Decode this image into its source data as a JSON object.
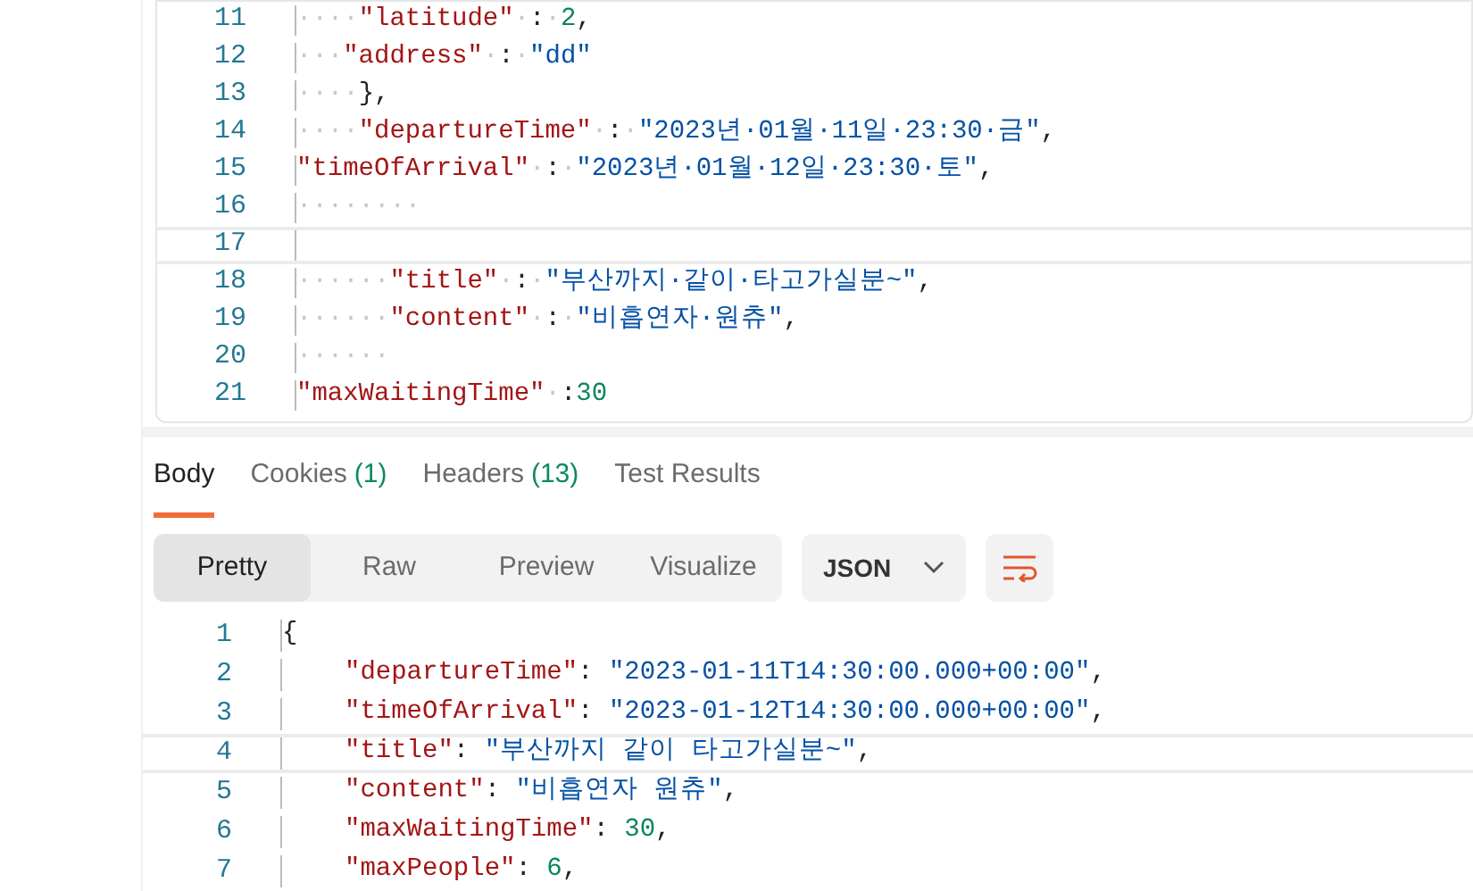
{
  "request_editor": {
    "lines": [
      {
        "number": "11",
        "active": false,
        "tokens": [
          {
            "kind": "space",
            "text": "····"
          },
          {
            "kind": "key",
            "text": "\"latitude\""
          },
          {
            "kind": "space",
            "text": "·"
          },
          {
            "kind": "punct",
            "text": ":"
          },
          {
            "kind": "space",
            "text": "·"
          },
          {
            "kind": "number",
            "text": "2"
          },
          {
            "kind": "punct",
            "text": ","
          }
        ]
      },
      {
        "number": "12",
        "active": false,
        "tokens": [
          {
            "kind": "space",
            "text": "···"
          },
          {
            "kind": "key",
            "text": "\"address\""
          },
          {
            "kind": "space",
            "text": "·"
          },
          {
            "kind": "punct",
            "text": ":"
          },
          {
            "kind": "space",
            "text": "·"
          },
          {
            "kind": "string",
            "text": "\"dd\""
          }
        ]
      },
      {
        "number": "13",
        "active": false,
        "tokens": [
          {
            "kind": "space",
            "text": "····"
          },
          {
            "kind": "punct",
            "text": "},"
          }
        ]
      },
      {
        "number": "14",
        "active": false,
        "tokens": [
          {
            "kind": "space",
            "text": "····"
          },
          {
            "kind": "key",
            "text": "\"departureTime\""
          },
          {
            "kind": "space",
            "text": "·"
          },
          {
            "kind": "punct",
            "text": ":"
          },
          {
            "kind": "space",
            "text": "·"
          },
          {
            "kind": "string",
            "text": "\"2023년·01월·11일·23:30·금\""
          },
          {
            "kind": "punct",
            "text": ","
          }
        ]
      },
      {
        "number": "15",
        "active": false,
        "tokens": [
          {
            "kind": "key",
            "text": "\"timeOfArrival\""
          },
          {
            "kind": "space",
            "text": "·"
          },
          {
            "kind": "punct",
            "text": ":"
          },
          {
            "kind": "space",
            "text": "·"
          },
          {
            "kind": "string",
            "text": "\"2023년·01월·12일·23:30·토\""
          },
          {
            "kind": "punct",
            "text": ","
          }
        ]
      },
      {
        "number": "16",
        "active": false,
        "tokens": [
          {
            "kind": "space",
            "text": "········"
          }
        ]
      },
      {
        "number": "17",
        "active": true
      },
      {
        "number": "18",
        "active": false,
        "tokens": [
          {
            "kind": "space",
            "text": "······"
          },
          {
            "kind": "key",
            "text": "\"title\""
          },
          {
            "kind": "space",
            "text": "·"
          },
          {
            "kind": "punct",
            "text": ":"
          },
          {
            "kind": "space",
            "text": "·"
          },
          {
            "kind": "string",
            "text": "\"부산까지·같이·타고가실분~\""
          },
          {
            "kind": "punct",
            "text": ","
          }
        ]
      },
      {
        "number": "19",
        "active": false,
        "tokens": [
          {
            "kind": "space",
            "text": "······"
          },
          {
            "kind": "key",
            "text": "\"content\""
          },
          {
            "kind": "space",
            "text": "·"
          },
          {
            "kind": "punct",
            "text": ":"
          },
          {
            "kind": "space",
            "text": "·"
          },
          {
            "kind": "string",
            "text": "\"비흡연자·원츄\""
          },
          {
            "kind": "punct",
            "text": ","
          }
        ]
      },
      {
        "number": "20",
        "active": false,
        "tokens": [
          {
            "kind": "space",
            "text": "······"
          }
        ]
      },
      {
        "number": "21",
        "active": false,
        "tokens": [
          {
            "kind": "key",
            "text": "\"maxWaitingTime\""
          },
          {
            "kind": "space",
            "text": "·"
          },
          {
            "kind": "punct",
            "text": ":"
          },
          {
            "kind": "number",
            "text": "30"
          }
        ]
      }
    ]
  },
  "response_tabs": [
    {
      "label": "Body",
      "selected": true
    },
    {
      "label": "Cookies",
      "count": "(1)",
      "selected": false
    },
    {
      "label": "Headers",
      "count": "(13)",
      "selected": false
    },
    {
      "label": "Test Results",
      "selected": false
    }
  ],
  "view_modes": [
    {
      "label": "Pretty",
      "selected": true
    },
    {
      "label": "Raw",
      "selected": false
    },
    {
      "label": "Preview",
      "selected": false
    },
    {
      "label": "Visualize",
      "selected": false
    }
  ],
  "format_dropdown": {
    "value": "JSON"
  },
  "response_body": {
    "lines": [
      {
        "number": "1",
        "active": false,
        "tokens": [
          {
            "kind": "punct",
            "text": "{"
          }
        ]
      },
      {
        "number": "2",
        "active": false,
        "tokens": [
          {
            "kind": "key",
            "text": "\"departureTime\""
          },
          {
            "kind": "punct",
            "text": ": "
          },
          {
            "kind": "string",
            "text": "\"2023-01-11T14:30:00.000+00:00\""
          },
          {
            "kind": "punct",
            "text": ","
          }
        ]
      },
      {
        "number": "3",
        "active": false,
        "tokens": [
          {
            "kind": "key",
            "text": "\"timeOfArrival\""
          },
          {
            "kind": "punct",
            "text": ": "
          },
          {
            "kind": "string",
            "text": "\"2023-01-12T14:30:00.000+00:00\""
          },
          {
            "kind": "punct",
            "text": ","
          }
        ]
      },
      {
        "number": "4",
        "active": true,
        "tokens": [
          {
            "kind": "key",
            "text": "\"title\""
          },
          {
            "kind": "punct",
            "text": ": "
          },
          {
            "kind": "string",
            "text": "\"부산까지 같이 타고가실분~\""
          },
          {
            "kind": "punct",
            "text": ","
          }
        ]
      },
      {
        "number": "5",
        "active": false,
        "tokens": [
          {
            "kind": "key",
            "text": "\"content\""
          },
          {
            "kind": "punct",
            "text": ": "
          },
          {
            "kind": "string",
            "text": "\"비흡연자 원츄\""
          },
          {
            "kind": "punct",
            "text": ","
          }
        ]
      },
      {
        "number": "6",
        "active": false,
        "tokens": [
          {
            "kind": "key",
            "text": "\"maxWaitingTime\""
          },
          {
            "kind": "punct",
            "text": ": "
          },
          {
            "kind": "number",
            "text": "30"
          },
          {
            "kind": "punct",
            "text": ","
          }
        ]
      },
      {
        "number": "7",
        "active": false,
        "tokens": [
          {
            "kind": "key",
            "text": "\"maxPeople\""
          },
          {
            "kind": "punct",
            "text": ": "
          },
          {
            "kind": "number",
            "text": "6"
          },
          {
            "kind": "punct",
            "text": ","
          }
        ]
      }
    ]
  }
}
